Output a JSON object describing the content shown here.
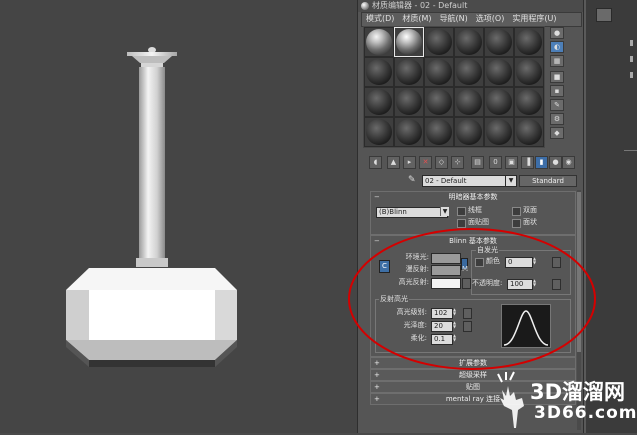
{
  "window": {
    "title": "材质编辑器 - 02 - Default"
  },
  "menu": [
    "模式(D)",
    "材质(M)",
    "导航(N)",
    "选项(O)",
    "实用程序(U)"
  ],
  "material": {
    "name": "02 - Default",
    "type": "Standard"
  },
  "shader_rollout": {
    "title": "明暗器基本参数",
    "shader": "(B)Blinn",
    "options": [
      {
        "label": "线框",
        "checked": false
      },
      {
        "label": "双面",
        "checked": false
      },
      {
        "label": "面贴图",
        "checked": false
      },
      {
        "label": "面状",
        "checked": false
      }
    ]
  },
  "blinn_rollout": {
    "title": "Blinn 基本参数",
    "self_illum_title": "自发光",
    "ambient_label": "环境光:",
    "diffuse_label": "漫反射:",
    "specular_label": "高光反射:",
    "color_label": "颜色",
    "self_illum_value": "0",
    "opacity_label": "不透明度:",
    "opacity_value": "100",
    "lock_glyph": "C",
    "diffuse_map_letter": "M",
    "specular_title": "反射高光",
    "spec_level_label": "高光级别:",
    "spec_level_value": "102",
    "glossiness_label": "光泽度:",
    "glossiness_value": "20",
    "soften_label": "柔化:",
    "soften_value": "0.1"
  },
  "closed_rollouts": [
    "扩展参数",
    "超级采样",
    "贴图",
    "mental ray 连接"
  ],
  "watermark": {
    "brand": "3D溜溜网",
    "url": "3D66.com"
  },
  "colors": {
    "ambient": "#9a9a9a",
    "diffuse": "#9a9a9a",
    "specular": "#f2f2f2",
    "annotation_circle": "#d40000"
  }
}
